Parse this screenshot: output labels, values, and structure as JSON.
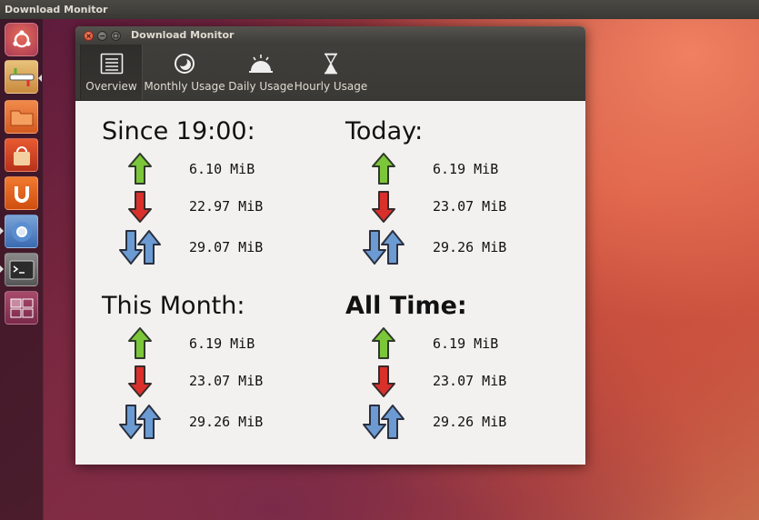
{
  "topbar": {
    "title": "Download Monitor"
  },
  "window": {
    "title": "Download Monitor"
  },
  "toolbar": {
    "tabs": [
      {
        "label": "Overview",
        "icon": "list-icon"
      },
      {
        "label": "Monthly Usage",
        "icon": "moon-icon"
      },
      {
        "label": "Daily Usage",
        "icon": "sunrise-icon"
      },
      {
        "label": "Hourly Usage",
        "icon": "hourglass-icon"
      }
    ],
    "active": 0
  },
  "sections": [
    {
      "title": "Since 19:00:",
      "upload": "6.10 MiB",
      "download": "22.97 MiB",
      "total": "29.07 MiB"
    },
    {
      "title": "Today:",
      "upload": "6.19 MiB",
      "download": "23.07 MiB",
      "total": "29.26 MiB"
    },
    {
      "title": "This Month:",
      "upload": "6.19 MiB",
      "download": "23.07 MiB",
      "total": "29.26 MiB"
    },
    {
      "title": "All Time:",
      "upload": "6.19 MiB",
      "download": "23.07 MiB",
      "total": "29.26 MiB"
    }
  ],
  "colors": {
    "upload": "#7cc63a",
    "download": "#d9302c",
    "total": "#6b9bd2"
  }
}
